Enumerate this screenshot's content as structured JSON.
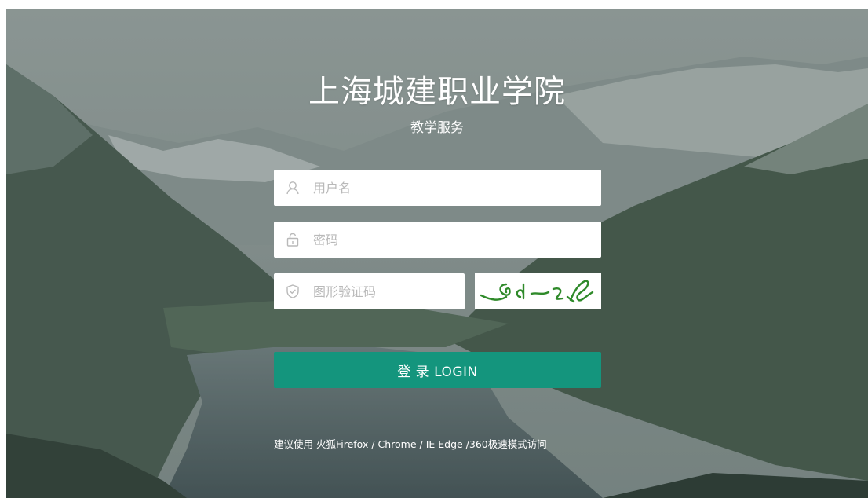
{
  "header": {
    "title": "上海城建职业学院",
    "subtitle": "教学服务"
  },
  "form": {
    "username_placeholder": "用户名",
    "username_value": "",
    "password_placeholder": "密码",
    "password_value": "",
    "captcha_placeholder": "图形验证码",
    "captcha_value": "",
    "login_label": "登 录 LOGIN"
  },
  "icons": {
    "username": "user-icon",
    "password": "lock-icon",
    "captcha": "shield-check-icon"
  },
  "footer": {
    "browser_hint": "建议使用 火狐Firefox / Chrome / IE Edge /360极速模式访问"
  },
  "colors": {
    "login_button": "#14957d",
    "input_background": "#ffffff",
    "placeholder": "#b9b9b9",
    "captcha_stroke": "#2f8a2a"
  }
}
